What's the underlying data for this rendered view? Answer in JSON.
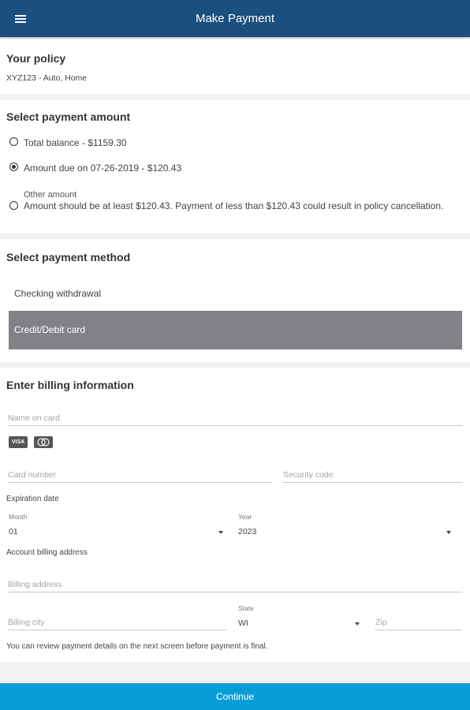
{
  "header": {
    "title": "Make Payment",
    "menu_icon": "hamburger-menu-icon"
  },
  "policy": {
    "title": "Your policy",
    "text": "XYZ123 - Auto, Home"
  },
  "amount": {
    "title": "Select payment amount",
    "options": [
      {
        "label": "Total balance - $1159.30",
        "selected": false
      },
      {
        "label": "Amount due on 07-26-2019 - $120.43",
        "selected": true
      },
      {
        "title": "Other amount",
        "note": "Amount should be at least $120.43.  Payment of less than $120.43 could result in policy cancellation.",
        "selected": false
      }
    ]
  },
  "method": {
    "title": "Select payment method",
    "options": [
      {
        "label": "Checking withdrawal",
        "selected": false
      },
      {
        "label": "Credit/Debit card",
        "selected": true
      }
    ],
    "selected_color": "#808286"
  },
  "billing": {
    "title": "Enter billing information",
    "name_placeholder": "Name on card",
    "card_logos": [
      "VISA",
      "mastercard-icon"
    ],
    "card_number_placeholder": "Card number",
    "security_placeholder": "Security code",
    "expiration_label": "Expiration date",
    "month_label": "Month",
    "month_value": "01",
    "year_label": "Year",
    "year_value": "2023",
    "address_label": "Account billing address",
    "address_placeholder": "Billing address",
    "city_placeholder": "Billing city",
    "state_label": "State",
    "state_value": "WI",
    "zip_placeholder": "Zip",
    "review_note": "You can review payment details on the next screen before payment is final."
  },
  "footer": {
    "continue_label": "Continue",
    "color": "#079ed8"
  },
  "colors": {
    "header_bg": "#1b4f7e"
  }
}
